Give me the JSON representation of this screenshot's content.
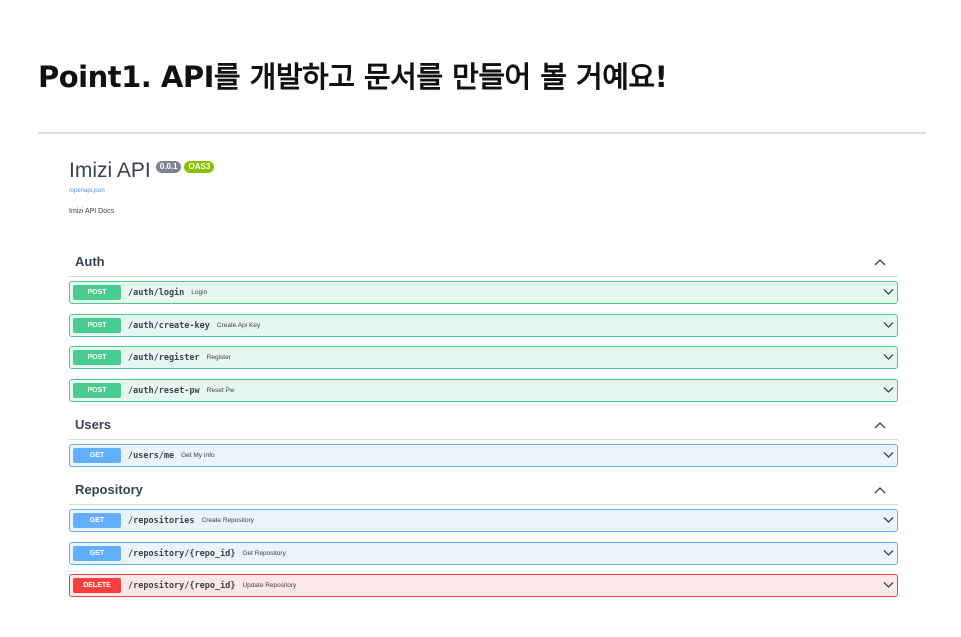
{
  "slide": {
    "title": "Point1. API를 개발하고 문서를 만들어 볼 거예요!"
  },
  "api": {
    "title": "Imizi API",
    "version": "0.0.1",
    "oas": "OAS3",
    "spec_link": "/openapi.json",
    "description": "Imizi API Docs"
  },
  "colors": {
    "post": "#49cc90",
    "get": "#61affe",
    "delete": "#f93e3e"
  },
  "tags": [
    {
      "name": "Auth",
      "expanded": true,
      "operations": [
        {
          "method": "POST",
          "path": "/auth/login",
          "summary": "Login"
        },
        {
          "method": "POST",
          "path": "/auth/create-key",
          "summary": "Create Api Key"
        },
        {
          "method": "POST",
          "path": "/auth/register",
          "summary": "Register"
        },
        {
          "method": "POST",
          "path": "/auth/reset-pw",
          "summary": "Reset Pw"
        }
      ]
    },
    {
      "name": "Users",
      "expanded": true,
      "operations": [
        {
          "method": "GET",
          "path": "/users/me",
          "summary": "Get My Info"
        }
      ]
    },
    {
      "name": "Repository",
      "expanded": true,
      "operations": [
        {
          "method": "GET",
          "path": "/repositories",
          "summary": "Create Repository"
        },
        {
          "method": "GET",
          "path": "/repository/{repo_id}",
          "summary": "Get Repository"
        },
        {
          "method": "DELETE",
          "path": "/repository/{repo_id}",
          "summary": "Update Repository"
        }
      ]
    }
  ],
  "icons": {
    "collapse": "chevron-up-icon",
    "expand": "chevron-down-icon"
  }
}
